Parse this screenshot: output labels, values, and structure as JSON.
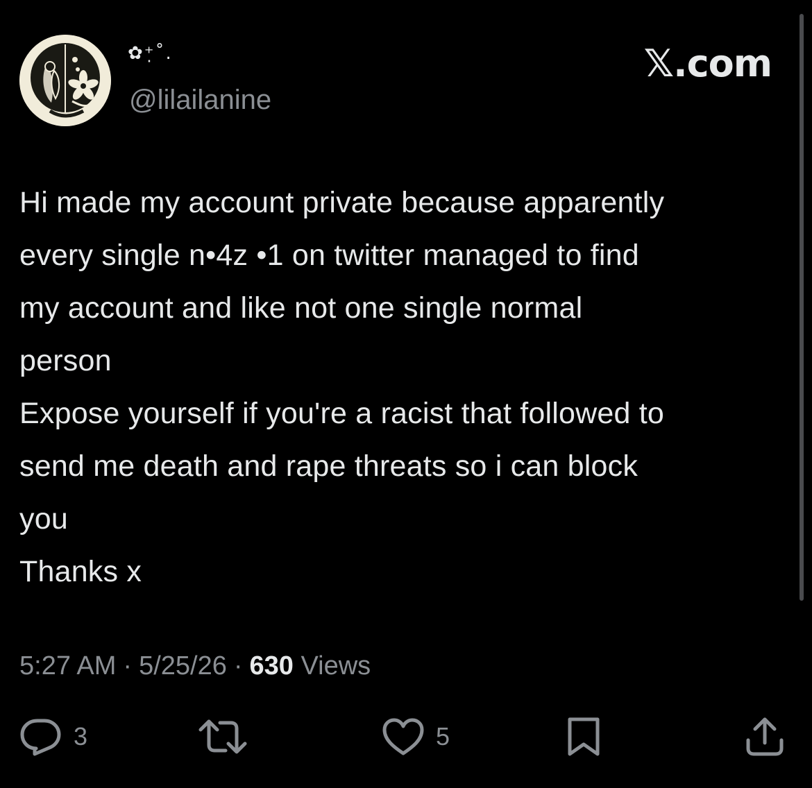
{
  "header": {
    "display_name": "✿⁺̣˚.",
    "handle": "@lilailanine",
    "brand": "𝕏.com",
    "avatar": "floral-illustration-avatar"
  },
  "tweet": {
    "lines": [
      "Hi made my account private because apparently",
      "every single n•4z •1 on twitter managed to find",
      "my account and like not one single normal",
      "person",
      "Expose yourself if you're a racist that followed to",
      "send me death and rape threats so i can block",
      "you",
      "Thanks x"
    ]
  },
  "meta": {
    "time": "5:27 AM",
    "separator": "·",
    "date": "5/25/26",
    "views_count": "630",
    "views_label": "Views"
  },
  "actions": {
    "reply": {
      "icon": "reply-icon",
      "count": "3"
    },
    "repost": {
      "icon": "repost-icon",
      "count": ""
    },
    "like": {
      "icon": "heart-icon",
      "count": "5"
    },
    "bookmark": {
      "icon": "bookmark-icon"
    },
    "share": {
      "icon": "share-icon"
    }
  },
  "colors": {
    "background": "#000000",
    "text_primary": "#e7e9ea",
    "text_secondary": "#8b8f94"
  }
}
